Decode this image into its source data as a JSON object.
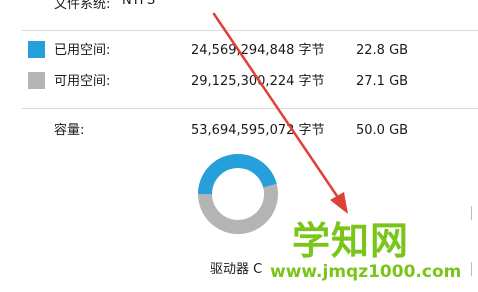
{
  "file_system": {
    "label": "文件系统:",
    "value": "NTFS"
  },
  "used": {
    "label": "已用空间:",
    "bytes": "24,569,294,848 字节",
    "size": "22.8 GB",
    "color": "#26a0da"
  },
  "free": {
    "label": "可用空间:",
    "bytes": "29,125,300,224 字节",
    "size": "27.1 GB",
    "color": "#b4b4b4"
  },
  "capacity": {
    "label": "容量:",
    "bytes": "53,694,595,072 字节",
    "size": "50.0 GB"
  },
  "usage": {
    "used_fraction": 0.458
  },
  "drive": {
    "label": "驱动器 C"
  },
  "watermark": {
    "title": "学知网",
    "url": "www.jmqz1000.com"
  },
  "accent": {
    "arrow": "#e0403a",
    "watermark": "#7ac51a"
  }
}
